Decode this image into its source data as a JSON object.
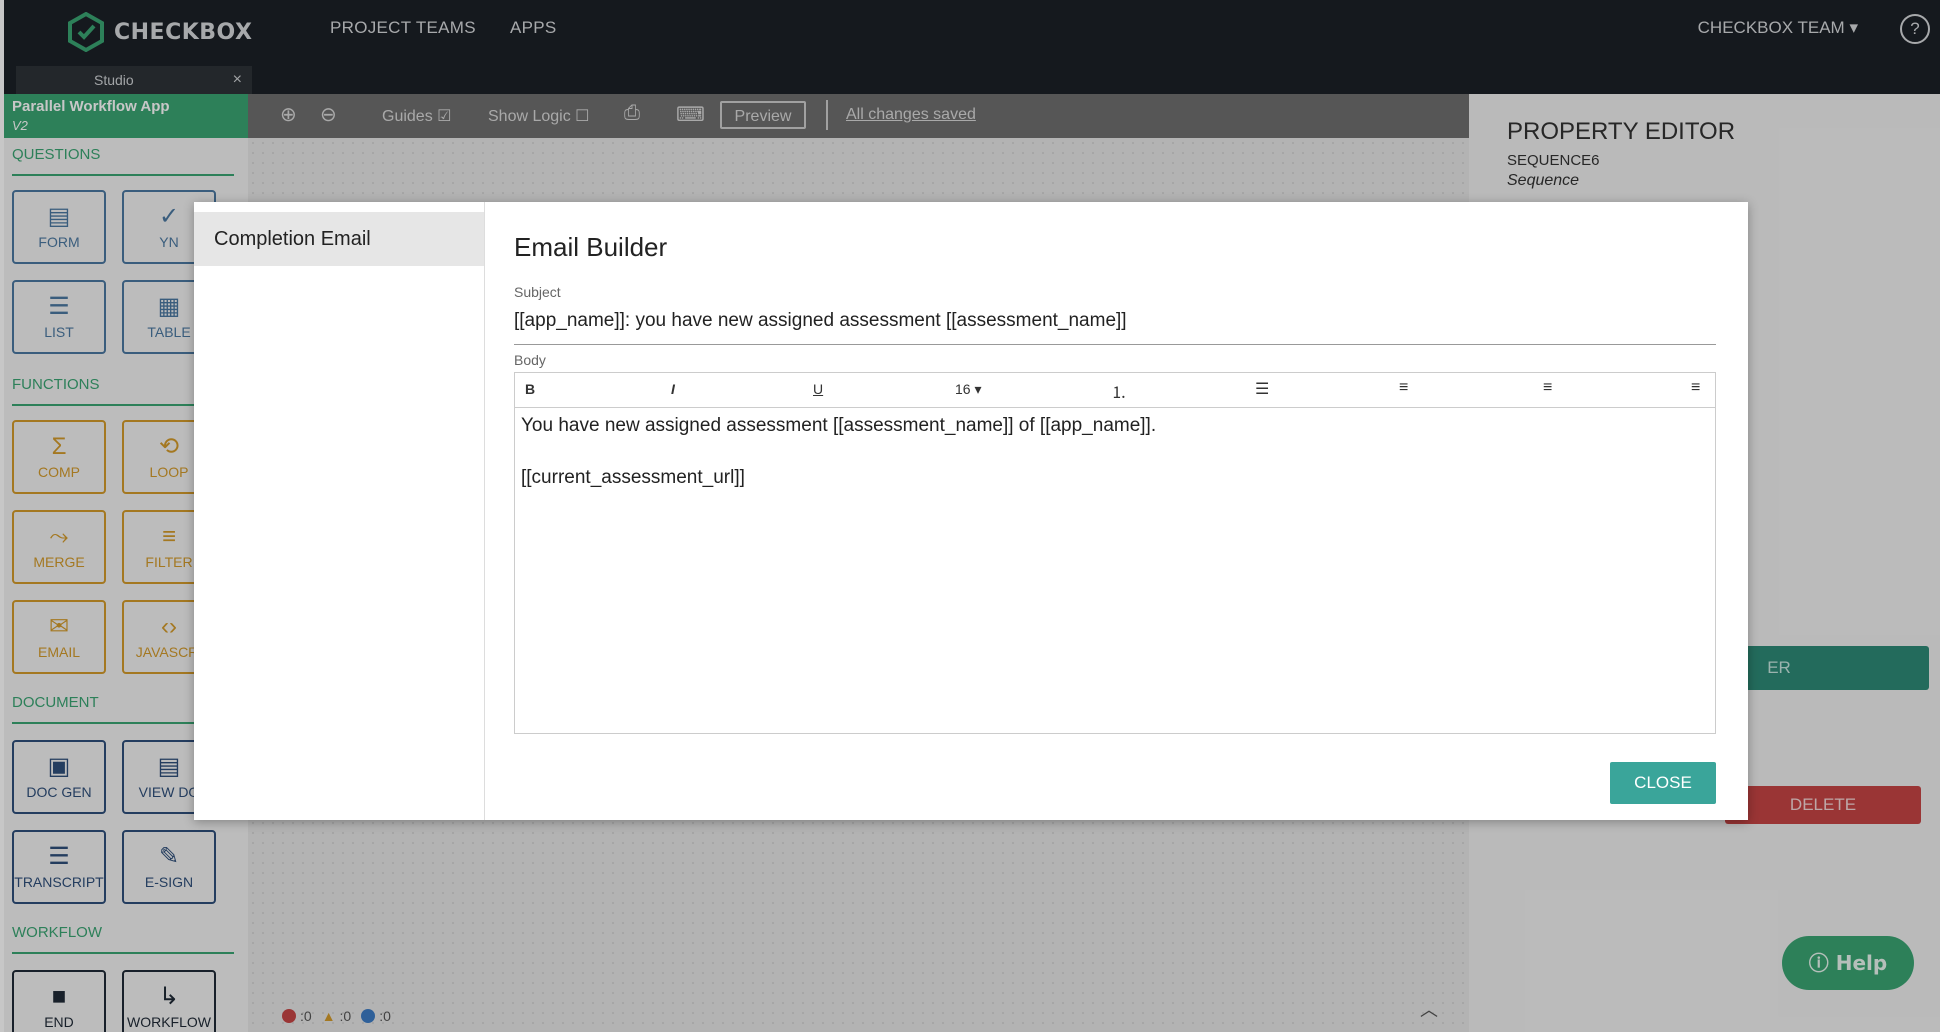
{
  "topbar": {
    "brand": "CHECKBOX",
    "nav": [
      "PROJECT TEAMS",
      "APPS"
    ],
    "team": "CHECKBOX TEAM",
    "help": "?"
  },
  "studio_tab": {
    "label": "Studio",
    "close": "×"
  },
  "sidebar": {
    "app_name": "Parallel Workflow App",
    "version": "V2",
    "sections": [
      {
        "title": "QUESTIONS",
        "tools": [
          {
            "label": "FORM",
            "icon": "form-icon"
          },
          {
            "label": "YN",
            "icon": "check-icon"
          },
          {
            "label": "LIST",
            "icon": "list-icon"
          },
          {
            "label": "TABLE",
            "icon": "table-icon"
          }
        ]
      },
      {
        "title": "FUNCTIONS",
        "tools": [
          {
            "label": "COMP",
            "icon": "sigma-icon"
          },
          {
            "label": "LOOP",
            "icon": "loop-icon"
          },
          {
            "label": "MERGE",
            "icon": "merge-icon"
          },
          {
            "label": "FILTER",
            "icon": "filter-icon"
          },
          {
            "label": "EMAIL",
            "icon": "envelope-icon"
          },
          {
            "label": "JAVASCRI",
            "icon": "code-icon"
          }
        ]
      },
      {
        "title": "DOCUMENT",
        "tools": [
          {
            "label": "DOC GEN",
            "icon": "doc-add-icon"
          },
          {
            "label": "VIEW DO",
            "icon": "doc-icon"
          },
          {
            "label": "TRANSCRIPT",
            "icon": "transcript-icon"
          },
          {
            "label": "E-SIGN",
            "icon": "pen-icon"
          }
        ]
      },
      {
        "title": "WORKFLOW",
        "tools": [
          {
            "label": "END",
            "icon": "stop-icon"
          },
          {
            "label": "WORKFLOW",
            "icon": "arrow-icon"
          }
        ]
      }
    ]
  },
  "toolbar": {
    "guides": "Guides",
    "show_logic": "Show Logic",
    "preview": "Preview",
    "status": "All changes saved"
  },
  "status_bar": {
    "errors": ":0",
    "warnings": ":0",
    "info": ":0"
  },
  "property_editor": {
    "title": "PROPERTY EDITOR",
    "subtitle": "SEQUENCE6",
    "type": "Sequence",
    "partial_button": "ER",
    "delete": "DELETE"
  },
  "help_fab": "Help",
  "modal": {
    "nav_item": "Completion Email",
    "title": "Email Builder",
    "subject_label": "Subject",
    "subject_value": "[[app_name]]: you have new assigned assessment [[assessment_name]]",
    "body_label": "Body",
    "toolbar": {
      "bold": "B",
      "italic": "I",
      "underline": "U",
      "font_size": "16"
    },
    "body_lines": [
      "You have new assigned assessment [[assessment_name]] of [[app_name]].",
      "",
      "[[current_assessment_url]]"
    ],
    "close": "CLOSE"
  },
  "colors": {
    "topbar": "#1c2027",
    "accent_green": "#3aa473",
    "teal": "#3aa59a",
    "danger": "#c64444",
    "question_blue": "#4b78a0",
    "function_orange": "#d39a2b"
  }
}
